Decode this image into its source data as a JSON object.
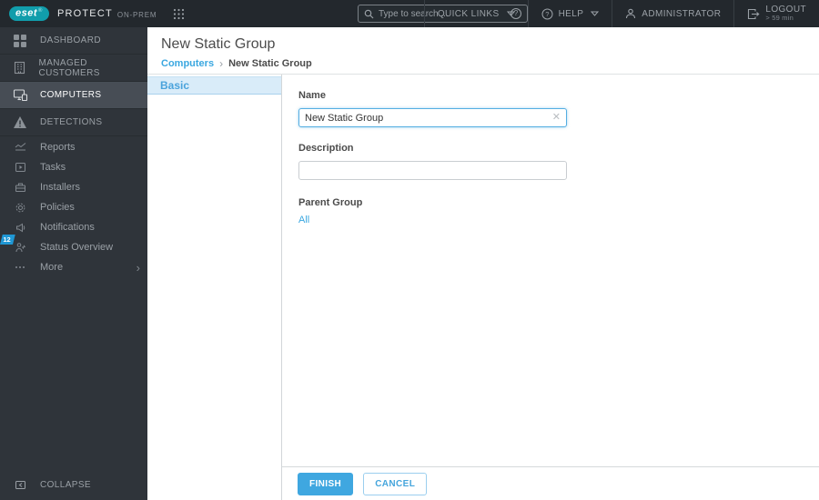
{
  "topbar": {
    "brand": {
      "logo": "eset",
      "reg": "®",
      "product": "PROTECT",
      "edition": "ON-PREM"
    },
    "search": {
      "placeholder": "Type to search ..."
    },
    "quick_links": "QUICK LINKS",
    "help": "HELP",
    "user": "ADMINISTRATOR",
    "logout": {
      "label": "LOGOUT",
      "timeout": "> 59 min"
    }
  },
  "sidebar": {
    "primary": [
      {
        "label": "DASHBOARD"
      },
      {
        "label": "MANAGED CUSTOMERS"
      },
      {
        "label": "COMPUTERS"
      },
      {
        "label": "DETECTIONS"
      }
    ],
    "secondary": [
      {
        "label": "Reports"
      },
      {
        "label": "Tasks"
      },
      {
        "label": "Installers"
      },
      {
        "label": "Policies"
      },
      {
        "label": "Notifications"
      },
      {
        "label": "Status Overview",
        "badge": "12"
      },
      {
        "label": "More"
      }
    ],
    "collapse": "COLLAPSE"
  },
  "page": {
    "title": "New Static Group",
    "breadcrumb": {
      "parent": "Computers",
      "current": "New Static Group"
    }
  },
  "wizard": {
    "step_basic": "Basic"
  },
  "form": {
    "name": {
      "label": "Name",
      "value": "New Static Group"
    },
    "description": {
      "label": "Description",
      "value": ""
    },
    "parent_group": {
      "label": "Parent Group",
      "value": "All"
    }
  },
  "footer": {
    "finish": "FINISH",
    "cancel": "CANCEL"
  },
  "colors": {
    "accent": "#3aa7e0",
    "topbar": "#23282d",
    "sidebar": "#2f343a",
    "selected_item": "#474d55",
    "eset_teal": "#119dab",
    "step_selected_bg": "#d9ecf9",
    "badge_blue": "#1f97d4"
  }
}
